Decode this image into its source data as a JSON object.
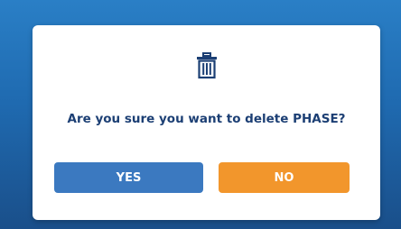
{
  "dialog": {
    "icon": "trash-icon",
    "message": "Are you sure you want to delete PHASE?",
    "yes_label": "YES",
    "no_label": "NO"
  },
  "colors": {
    "background": "#1f6ab0",
    "message": "#1c3f74",
    "yes_button": "#3b79c0",
    "no_button": "#f2962c"
  }
}
